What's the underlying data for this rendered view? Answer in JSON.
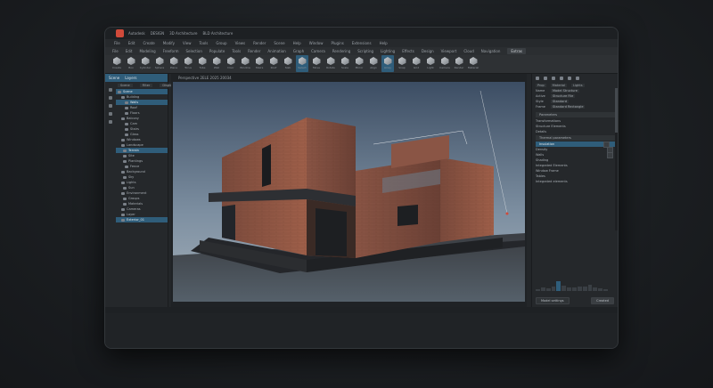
{
  "app": {
    "title_items": [
      "Autodesk",
      "DESIGN",
      "3D Architecture",
      "BLD Architecture"
    ],
    "accent": "#2f5d7a",
    "logo_color": "#d04a3a"
  },
  "menu": [
    "File",
    "Edit",
    "Create",
    "Modify",
    "View",
    "Tools",
    "Group",
    "Views",
    "Render",
    "Scene",
    "Help",
    "Window",
    "Plugins",
    "Extensions",
    "Help"
  ],
  "toolbar_tabs": [
    "File",
    "Edit",
    "Modeling",
    "Freeform",
    "Selection",
    "Populate",
    "Tools",
    "Render",
    "Animation",
    "Graph",
    "Camera",
    "Rendering",
    "Scripting",
    "Lighting",
    "Effects",
    "Design",
    "Viewport",
    "Cloud",
    "Navigation",
    "Extras"
  ],
  "ribbon_tools": [
    {
      "label": "Create",
      "selected": false
    },
    {
      "label": "Box",
      "selected": false
    },
    {
      "label": "Cylinder",
      "selected": false
    },
    {
      "label": "Sphere",
      "selected": false
    },
    {
      "label": "Plane",
      "selected": false
    },
    {
      "label": "Torus",
      "selected": false
    },
    {
      "label": "Tube",
      "selected": false
    },
    {
      "label": "Wall",
      "selected": false
    },
    {
      "label": "Door",
      "selected": false
    },
    {
      "label": "Window",
      "selected": false
    },
    {
      "label": "Stairs",
      "selected": false
    },
    {
      "label": "Roof",
      "selected": false
    },
    {
      "label": "Slab",
      "selected": false
    },
    {
      "label": "Select",
      "selected": true
    },
    {
      "label": "Move",
      "selected": false
    },
    {
      "label": "Rotate",
      "selected": false
    },
    {
      "label": "Scale",
      "selected": false
    },
    {
      "label": "Mirror",
      "selected": false
    },
    {
      "label": "Align",
      "selected": false
    },
    {
      "label": "Array",
      "selected": true
    },
    {
      "label": "Snap",
      "selected": false
    },
    {
      "label": "Grid",
      "selected": false
    },
    {
      "label": "Light",
      "selected": false
    },
    {
      "label": "Camera",
      "selected": false
    },
    {
      "label": "Render",
      "selected": false
    },
    {
      "label": "Material",
      "selected": false
    }
  ],
  "left_panel": {
    "header": [
      "Scene",
      "Layers"
    ],
    "tabs": [
      "Scene",
      "Filter",
      "Display"
    ],
    "tree": [
      {
        "label": "Scene",
        "hl": true,
        "indent": 0
      },
      {
        "label": "Building",
        "hl": false,
        "indent": 4
      },
      {
        "label": "Walls",
        "hl": true,
        "indent": 8
      },
      {
        "label": "Roof",
        "hl": false,
        "indent": 8
      },
      {
        "label": "Floors",
        "hl": false,
        "indent": 8
      },
      {
        "label": "Balcony",
        "hl": false,
        "indent": 4
      },
      {
        "label": "Cam",
        "hl": false,
        "indent": 8
      },
      {
        "label": "Stairs",
        "hl": false,
        "indent": 8
      },
      {
        "label": "Glass",
        "hl": false,
        "indent": 8
      },
      {
        "label": "Windows",
        "hl": false,
        "indent": 4
      },
      {
        "label": "Landscape",
        "hl": false,
        "indent": 4
      },
      {
        "label": "Terrain",
        "hl": true,
        "indent": 6
      },
      {
        "label": "Site",
        "hl": false,
        "indent": 6
      },
      {
        "label": "Plantings",
        "hl": false,
        "indent": 6
      },
      {
        "label": "Fence",
        "hl": false,
        "indent": 8
      },
      {
        "label": "Background",
        "hl": false,
        "indent": 4
      },
      {
        "label": "Sky",
        "hl": false,
        "indent": 6
      },
      {
        "label": "Lights",
        "hl": false,
        "indent": 4
      },
      {
        "label": "Sun",
        "hl": false,
        "indent": 6
      },
      {
        "label": "Environment",
        "hl": false,
        "indent": 4
      },
      {
        "label": "Groups",
        "hl": false,
        "indent": 6
      },
      {
        "label": "Materials",
        "hl": false,
        "indent": 6
      },
      {
        "label": "Cameras",
        "hl": false,
        "indent": 4
      },
      {
        "label": "Layer",
        "hl": false,
        "indent": 4
      },
      {
        "label": "Exterior_01",
        "hl": true,
        "indent": 4
      }
    ]
  },
  "viewport": {
    "label": "Perspective 2ELE 2025 20034"
  },
  "right_panel": {
    "tabs": [
      "Prop",
      "Material",
      "Lights"
    ],
    "properties": [
      {
        "k": "Name",
        "v": "Model Structure"
      },
      {
        "k": "Active",
        "v": "Structure File"
      },
      {
        "k": "Style",
        "v": "Standard"
      },
      {
        "k": "Frame",
        "v": "Standard Rectangle"
      }
    ],
    "dropdown": "Parameters",
    "sections": [
      {
        "label": "Transformations",
        "type": "plain"
      },
      {
        "label": "Structure Elements",
        "type": "plain"
      },
      {
        "label": "Details",
        "type": "plain"
      },
      {
        "label": "Thermal parameters",
        "type": "bar"
      },
      {
        "label": "Insulation",
        "type": "hl"
      },
      {
        "label": "Density",
        "type": "plain"
      },
      {
        "label": "Walls",
        "type": "plain"
      },
      {
        "label": "Shading",
        "type": "plain"
      },
      {
        "label": "Integrated Elements",
        "type": "plain"
      },
      {
        "label": "Window Frame",
        "type": "plain"
      },
      {
        "label": "Tables",
        "type": "plain"
      },
      {
        "label": "Integrated elements",
        "type": "plain"
      }
    ],
    "histogram": [
      0.2,
      0.3,
      0.25,
      0.4,
      0.9,
      0.5,
      0.35,
      0.3,
      0.45,
      0.4,
      0.6,
      0.3,
      0.25,
      0.2
    ],
    "buttons": [
      "Model settings",
      "Created"
    ]
  }
}
